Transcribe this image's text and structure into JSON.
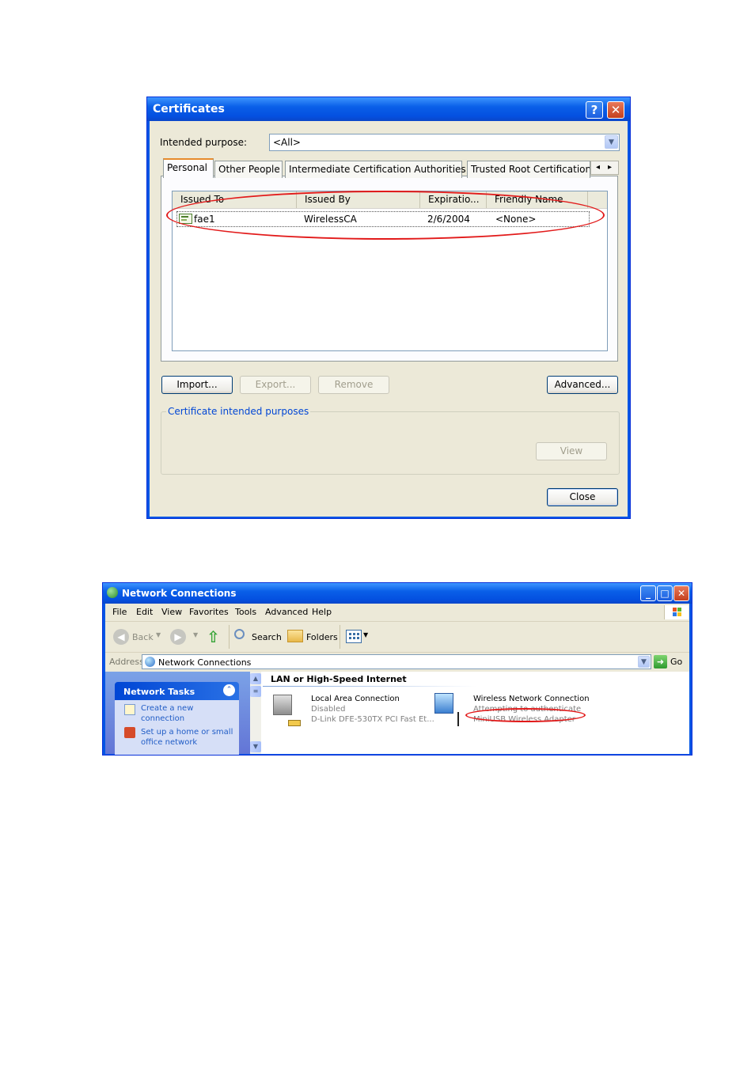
{
  "certificates": {
    "title": "Certificates",
    "help_glyph": "?",
    "close_glyph": "✕",
    "intended_purpose_label": "Intended purpose:",
    "intended_purpose_value": "<All>",
    "tabs": [
      "Personal",
      "Other People",
      "Intermediate Certification Authorities",
      "Trusted Root Certification"
    ],
    "tab_scroll_left": "◂",
    "tab_scroll_right": "▸",
    "columns": [
      "Issued To",
      "Issued By",
      "Expiratio...",
      "Friendly Name"
    ],
    "rows": [
      {
        "issued_to": "fae1",
        "issued_by": "WirelessCA",
        "expiration": "2/6/2004",
        "friendly_name": "<None>"
      }
    ],
    "buttons": {
      "import": "Import...",
      "export": "Export...",
      "remove": "Remove",
      "advanced": "Advanced...",
      "view": "View",
      "close": "Close"
    },
    "group_label": "Certificate intended purposes"
  },
  "network": {
    "title": "Network Connections",
    "window_buttons": [
      "_",
      "□",
      "✕"
    ],
    "menu": [
      "File",
      "Edit",
      "View",
      "Favorites",
      "Tools",
      "Advanced",
      "Help"
    ],
    "toolbar": {
      "back": "Back",
      "search": "Search",
      "folders": "Folders"
    },
    "address_label": "Address",
    "address_value": "Network Connections",
    "go_label": "Go",
    "tasks_title": "Network Tasks",
    "tasks": [
      {
        "line1": "Create a new",
        "line2": "connection"
      },
      {
        "line1": "Set up a home or small",
        "line2": "office network"
      }
    ],
    "section_title": "LAN or High-Speed Internet",
    "connections": [
      {
        "name": "Local Area Connection",
        "status": "Disabled",
        "device": "D-Link DFE-530TX PCI Fast Et..."
      },
      {
        "name": "Wireless Network Connection",
        "status": "Attempting to authenticate",
        "device": "MiniUSB Wireless Adapter"
      }
    ]
  }
}
